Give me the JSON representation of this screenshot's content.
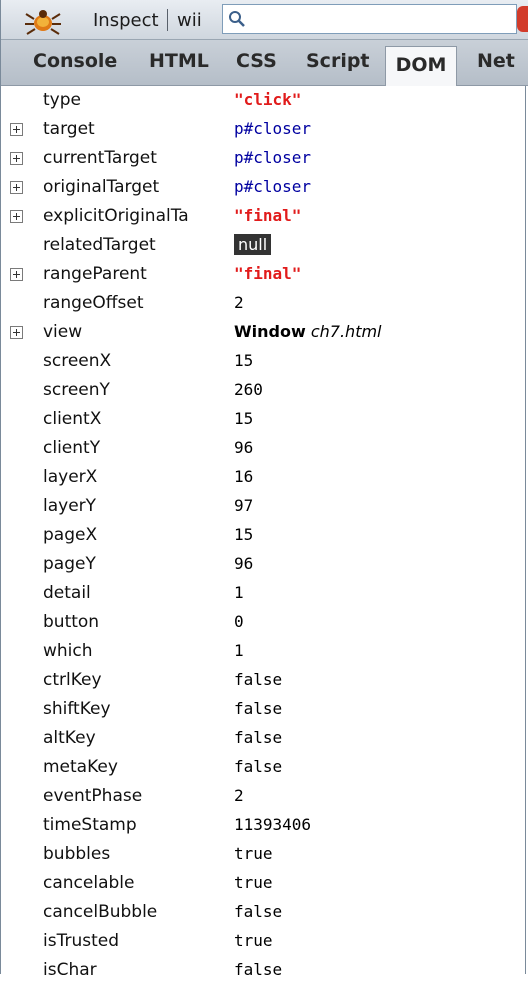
{
  "toolbar": {
    "inspect_label": "Inspect",
    "context_label": "wii",
    "search_value": ""
  },
  "tabs": {
    "console": "Console",
    "html": "HTML",
    "css": "CSS",
    "script": "Script",
    "dom": "DOM",
    "net": "Net"
  },
  "colors": {
    "string_value": "#e11b1b",
    "object_value": "#0000a0",
    "null_bg": "#333333"
  },
  "properties": [
    {
      "name": "type",
      "value": "\"click\"",
      "kind": "str",
      "expandable": false
    },
    {
      "name": "target",
      "value": "p#closer",
      "kind": "obj",
      "expandable": true
    },
    {
      "name": "currentTarget",
      "value": "p#closer",
      "kind": "obj",
      "expandable": true
    },
    {
      "name": "originalTarget",
      "value": "p#closer",
      "kind": "obj",
      "expandable": true
    },
    {
      "name": "explicitOriginalTa",
      "value": "\"final\"",
      "kind": "str",
      "expandable": true
    },
    {
      "name": "relatedTarget",
      "value": "null",
      "kind": "null",
      "expandable": false
    },
    {
      "name": "rangeParent",
      "value": "\"final\"",
      "kind": "str",
      "expandable": true
    },
    {
      "name": "rangeOffset",
      "value": "2",
      "kind": "num",
      "expandable": false
    },
    {
      "name": "view",
      "value": "Window",
      "value_extra": "ch7.html",
      "kind": "win",
      "expandable": true
    },
    {
      "name": "screenX",
      "value": "15",
      "kind": "num",
      "expandable": false
    },
    {
      "name": "screenY",
      "value": "260",
      "kind": "num",
      "expandable": false
    },
    {
      "name": "clientX",
      "value": "15",
      "kind": "num",
      "expandable": false
    },
    {
      "name": "clientY",
      "value": "96",
      "kind": "num",
      "expandable": false
    },
    {
      "name": "layerX",
      "value": "16",
      "kind": "num",
      "expandable": false
    },
    {
      "name": "layerY",
      "value": "97",
      "kind": "num",
      "expandable": false
    },
    {
      "name": "pageX",
      "value": "15",
      "kind": "num",
      "expandable": false
    },
    {
      "name": "pageY",
      "value": "96",
      "kind": "num",
      "expandable": false
    },
    {
      "name": "detail",
      "value": "1",
      "kind": "num",
      "expandable": false
    },
    {
      "name": "button",
      "value": "0",
      "kind": "num",
      "expandable": false
    },
    {
      "name": "which",
      "value": "1",
      "kind": "num",
      "expandable": false
    },
    {
      "name": "ctrlKey",
      "value": "false",
      "kind": "bool",
      "expandable": false
    },
    {
      "name": "shiftKey",
      "value": "false",
      "kind": "bool",
      "expandable": false
    },
    {
      "name": "altKey",
      "value": "false",
      "kind": "bool",
      "expandable": false
    },
    {
      "name": "metaKey",
      "value": "false",
      "kind": "bool",
      "expandable": false
    },
    {
      "name": "eventPhase",
      "value": "2",
      "kind": "num",
      "expandable": false
    },
    {
      "name": "timeStamp",
      "value": "11393406",
      "kind": "num",
      "expandable": false
    },
    {
      "name": "bubbles",
      "value": "true",
      "kind": "bool",
      "expandable": false
    },
    {
      "name": "cancelable",
      "value": "true",
      "kind": "bool",
      "expandable": false
    },
    {
      "name": "cancelBubble",
      "value": "false",
      "kind": "bool",
      "expandable": false
    },
    {
      "name": "isTrusted",
      "value": "true",
      "kind": "bool",
      "expandable": false
    },
    {
      "name": "isChar",
      "value": "false",
      "kind": "bool",
      "expandable": false
    }
  ]
}
